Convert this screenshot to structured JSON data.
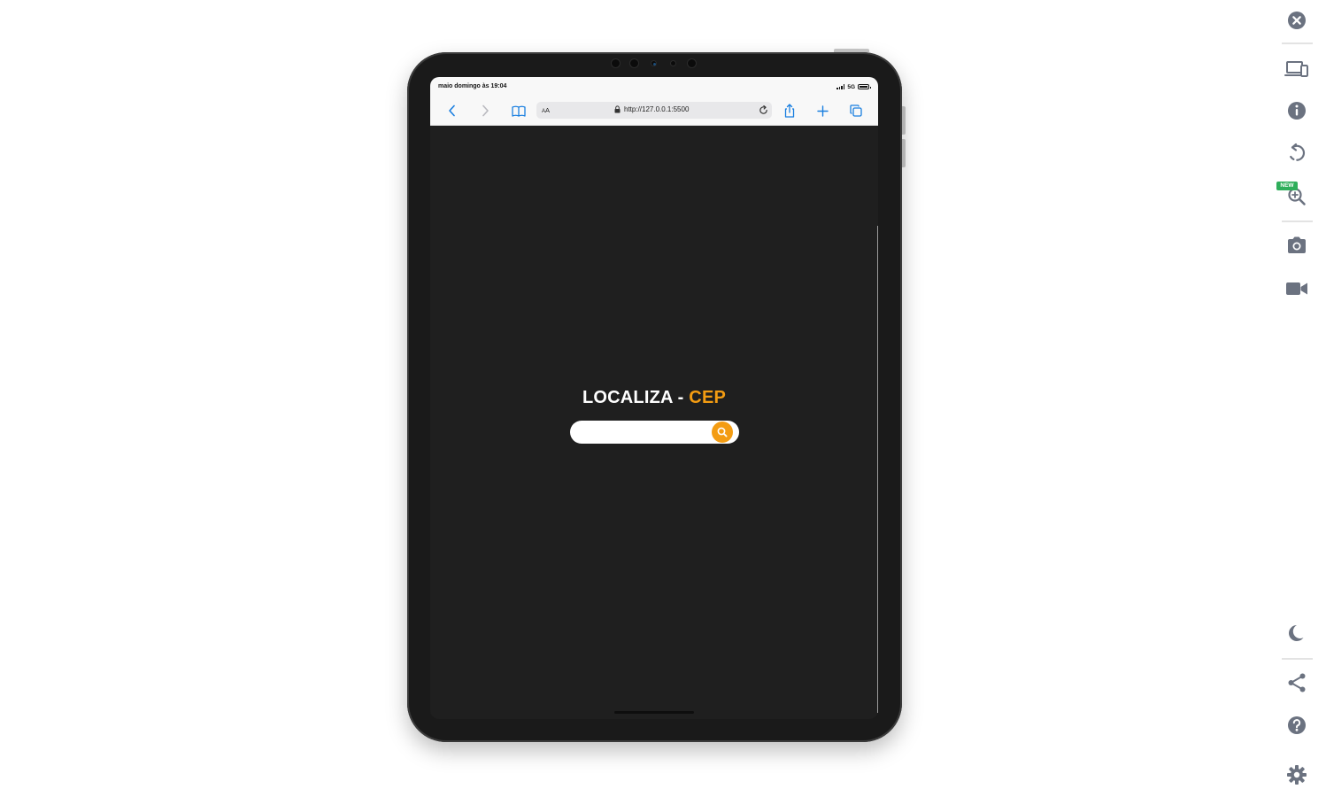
{
  "device": {
    "status_time": "maio domingo às 19:04",
    "network": "5G"
  },
  "browser": {
    "text_size_small": "A",
    "text_size_large": "A",
    "url": "http://127.0.0.1:5500"
  },
  "page": {
    "title_main": "LOCALIZA - ",
    "title_accent": "CEP",
    "accent_color": "#f39c12",
    "search_value": ""
  },
  "side_panel": {
    "new_badge": "NEW",
    "icons": [
      "close-icon",
      "devices-icon",
      "info-icon",
      "rotate-icon",
      "zoom-icon",
      "camera-icon",
      "video-icon",
      "dark-mode-icon",
      "share-icon",
      "help-icon",
      "settings-icon"
    ]
  }
}
